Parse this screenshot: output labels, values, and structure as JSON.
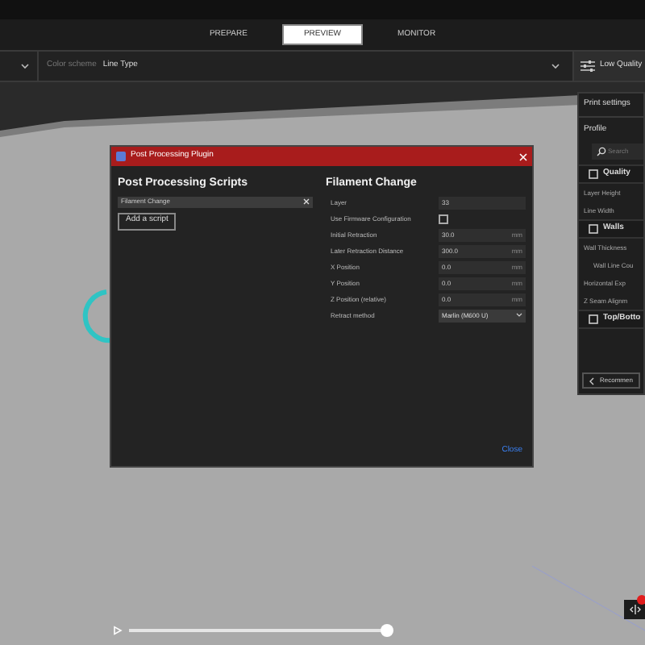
{
  "stages": [
    {
      "label": "PREPARE",
      "selected": false
    },
    {
      "label": "PREVIEW",
      "selected": true
    },
    {
      "label": "MONITOR",
      "selected": false
    }
  ],
  "toolbar": {
    "color_scheme_label": "Color scheme",
    "color_scheme_value": "Line Type",
    "profile_label": "Low Quality"
  },
  "print_settings": {
    "title": "Print settings",
    "profile_label": "Profile",
    "search_placeholder": "Search",
    "items": [
      {
        "kind": "section",
        "label": "Quality"
      },
      {
        "kind": "setting",
        "label": "Layer Height"
      },
      {
        "kind": "setting",
        "label": "Line Width"
      },
      {
        "kind": "section",
        "label": "Walls"
      },
      {
        "kind": "setting",
        "label": "Wall Thickness"
      },
      {
        "kind": "subsetting",
        "label": "Wall Line Cou"
      },
      {
        "kind": "setting",
        "label": "Horizontal Exp"
      },
      {
        "kind": "setting",
        "label": "Z Seam Alignm"
      },
      {
        "kind": "section",
        "label": "Top/Botto"
      }
    ],
    "recommended_button": "Recommen"
  },
  "dialog": {
    "title": "Post Processing Plugin",
    "scripts_heading": "Post Processing Scripts",
    "scripts": [
      {
        "label": "Filament Change",
        "selected": true
      }
    ],
    "add_button": "Add a script",
    "settings_heading": "Filament Change",
    "settings": [
      {
        "kind": "text",
        "label": "Layer",
        "value": "33"
      },
      {
        "kind": "checkbox",
        "label": "Use Firmware Configuration",
        "checked": false
      },
      {
        "kind": "text",
        "label": "Initial Retraction",
        "value": "30.0",
        "unit": "mm"
      },
      {
        "kind": "text",
        "label": "Later Retraction Distance",
        "value": "300.0",
        "unit": "mm"
      },
      {
        "kind": "text",
        "label": "X Position",
        "value": "0.0",
        "unit": "mm"
      },
      {
        "kind": "text",
        "label": "Y Position",
        "value": "0.0",
        "unit": "mm"
      },
      {
        "kind": "text",
        "label": "Z Position (relative)",
        "value": "0.0",
        "unit": "mm"
      },
      {
        "kind": "dropdown",
        "label": "Retract method",
        "value": "Marlin (M600 U)"
      }
    ],
    "close_button": "Close"
  },
  "layer_slider": {
    "level": 1.0
  }
}
